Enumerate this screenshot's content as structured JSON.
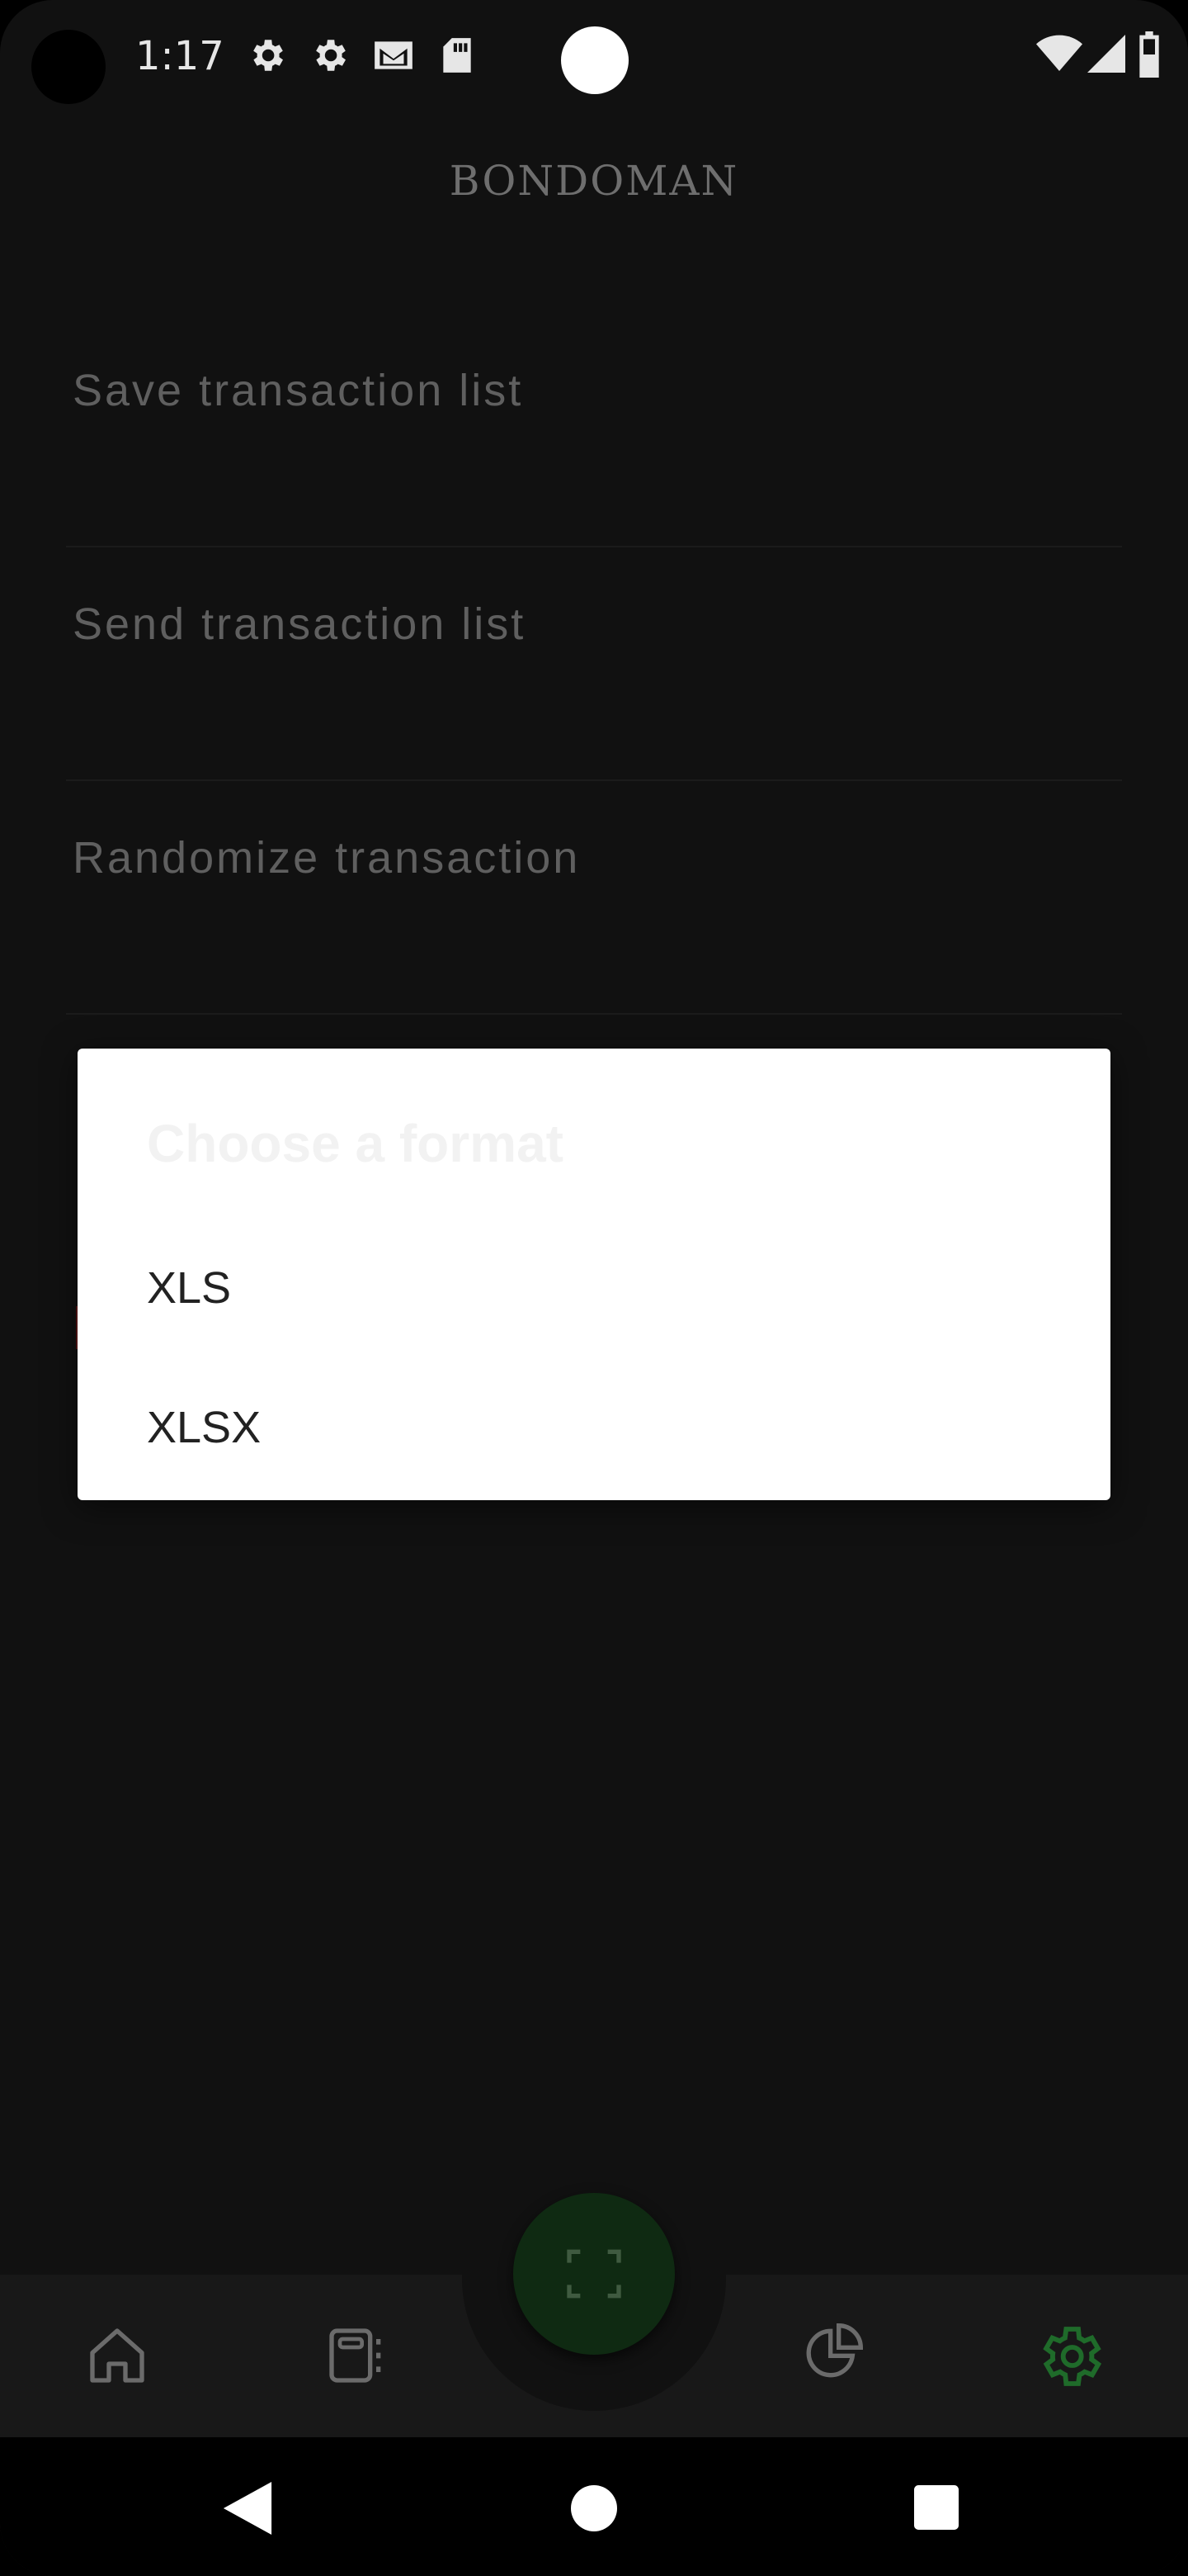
{
  "status_bar": {
    "time": "1:17",
    "left_icons": [
      "settings-icon",
      "settings-icon",
      "gmail-icon",
      "sd-card-icon"
    ],
    "right_icons": [
      "wifi-icon",
      "signal-icon",
      "battery-icon"
    ]
  },
  "app": {
    "title": "BONDOMAN"
  },
  "settings": {
    "items": [
      {
        "label": "Save transaction list"
      },
      {
        "label": "Send transaction list"
      },
      {
        "label": "Randomize transaction"
      }
    ]
  },
  "dialog": {
    "title": "Choose a format",
    "options": [
      {
        "label": "XLS"
      },
      {
        "label": "XLSX"
      }
    ]
  },
  "bottom_nav": {
    "items": [
      "home-icon",
      "transactions-icon",
      "scan-icon",
      "graph-icon",
      "settings-icon"
    ],
    "active": "settings",
    "accent_color": "#1f6b2a"
  },
  "system_nav": {
    "buttons": [
      "back-icon",
      "home-icon",
      "recents-icon"
    ]
  }
}
